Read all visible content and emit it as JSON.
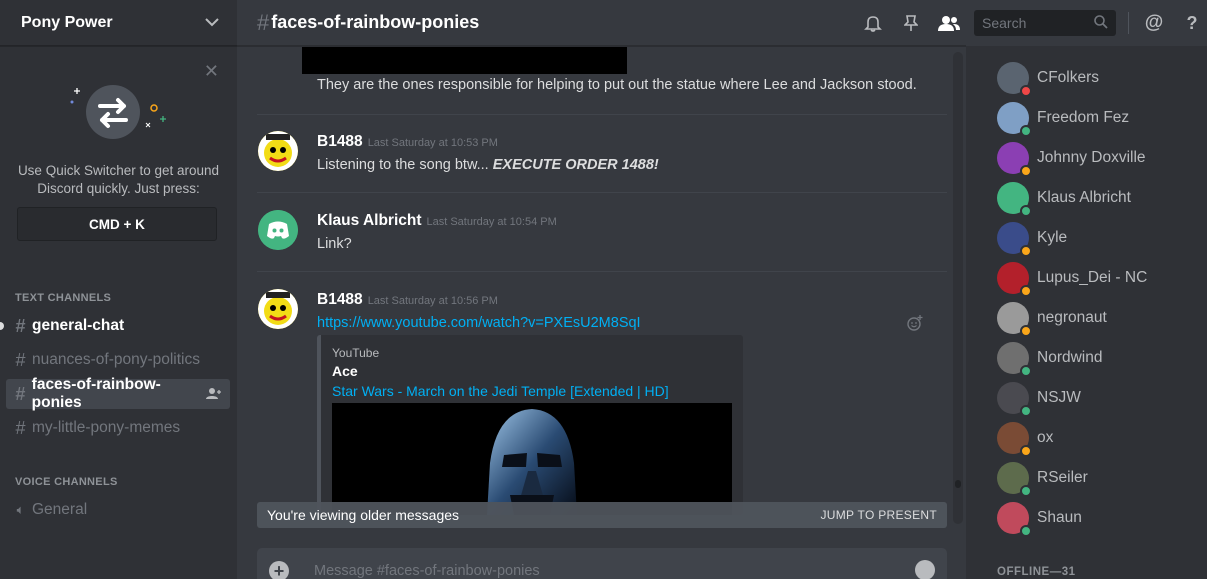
{
  "guild": {
    "name": "Pony Power"
  },
  "quick_switcher": {
    "text_line1": "Use Quick Switcher to get around",
    "text_line2": "Discord quickly. Just press:",
    "shortcut": "CMD + K"
  },
  "categories": {
    "text": "TEXT CHANNELS",
    "voice": "VOICE CHANNELS"
  },
  "channels": [
    {
      "name": "general-chat"
    },
    {
      "name": "nuances-of-pony-politics"
    },
    {
      "name": "faces-of-rainbow-ponies"
    },
    {
      "name": "my-little-pony-memes"
    }
  ],
  "voice_channels": [
    {
      "name": "General"
    }
  ],
  "header": {
    "channel": "faces-of-rainbow-ponies",
    "search_placeholder": "Search"
  },
  "messages": [
    {
      "text": "They are the ones responsible for helping to put out the statue where Lee and Jackson stood."
    },
    {
      "author": "B1488",
      "timestamp": "Last Saturday at 10:53 PM",
      "text": "Listening to the song btw...",
      "emphasis": "EXECUTE ORDER 1488!"
    },
    {
      "author": "Klaus Albricht",
      "timestamp": "Last Saturday at 10:54 PM",
      "text": "Link?"
    },
    {
      "author": "B1488",
      "timestamp": "Last Saturday at 10:56 PM",
      "link": "https://www.youtube.com/watch?v=PXEsU2M8SqI"
    }
  ],
  "embed": {
    "provider": "YouTube",
    "author": "Ace",
    "title": "Star Wars - March on the Jedi Temple [Extended | HD]"
  },
  "older_bar": {
    "text": "You're viewing older messages",
    "jump": "JUMP TO PRESENT"
  },
  "composer": {
    "placeholder": "Message #faces-of-rainbow-ponies"
  },
  "members": [
    {
      "name": "CFolkers",
      "status": "dnd",
      "color": "#5a6470"
    },
    {
      "name": "Freedom Fez",
      "status": "online",
      "color": "#7f9fc5"
    },
    {
      "name": "Johnny Doxville",
      "status": "idle",
      "color": "#8b3fb3"
    },
    {
      "name": "Klaus Albricht",
      "status": "online",
      "color": "#43b581"
    },
    {
      "name": "Kyle",
      "status": "idle",
      "color": "#3a4c8a"
    },
    {
      "name": "Lupus_Dei - NC",
      "status": "idle",
      "color": "#b3202b"
    },
    {
      "name": "negronaut",
      "status": "idle",
      "color": "#9a9a9a"
    },
    {
      "name": "Nordwind",
      "status": "online",
      "color": "#6f6f6f"
    },
    {
      "name": "NSJW",
      "status": "online",
      "color": "#4a4a50"
    },
    {
      "name": "ox",
      "status": "idle",
      "color": "#7a4b35"
    },
    {
      "name": "RSeiler",
      "status": "online",
      "color": "#5d6b4c"
    },
    {
      "name": "Shaun",
      "status": "online",
      "color": "#c04a5c"
    }
  ],
  "offline_label": "OFFLINE—31",
  "colors": {
    "online": "#43b581",
    "idle": "#faa61a",
    "dnd": "#f04747",
    "link": "#00b0f4"
  }
}
